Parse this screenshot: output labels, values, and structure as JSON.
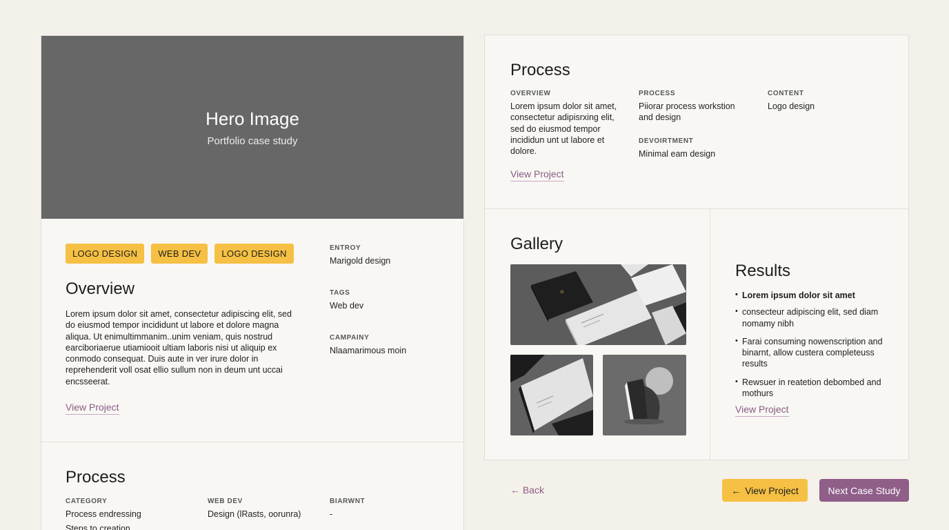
{
  "hero": {
    "title": "Hero Image",
    "subtitle": "Portfolio case study"
  },
  "overview": {
    "tags": [
      "LOGO DESIGN",
      "WEB DEV",
      "LOGO DESIGN"
    ],
    "heading": "Overview",
    "body": "Lorem ipsum dolor sit amet, consectetur adipiscing elit, sed do eiusmod tempor incididunt ut labore et dolore magna aliqua. Ut enimultimmanim..unim veniam, quis nostrud earciboriaerue utiamiooit ultiam laboris nisi ut aliquip ex conmodo consequat. Duis aute in ver irure dolor in reprehenderit voll osat ellio sullum non in deum unt uccai encsseerat.",
    "link": "View Project",
    "meta": [
      {
        "label": "ENTROY",
        "value": "Marigold design"
      },
      {
        "label": "TAGS",
        "value": "Web dev"
      },
      {
        "label": "CAMPAINY",
        "value": "Nlaamarimous moin"
      }
    ]
  },
  "process_left": {
    "heading": "Process",
    "columns": [
      {
        "label": "CATEGORY",
        "value": "Process endressing",
        "value2": "Steps to creation"
      },
      {
        "label": "WEB DEV",
        "value": "Design (lRasts, oorunra)"
      },
      {
        "label": "BIARWNT",
        "value": "-"
      }
    ]
  },
  "process_right": {
    "heading": "Process",
    "overview_label": "OVERVIEW",
    "overview_text": "Lorem ipsum dolor sit amet, consectetur adipisrxing elit, sed do eiusmod tempor incididun unt ut labore et dolore.",
    "process_label": "PROCESS",
    "process_text": "Piiorar process workstion and design",
    "devoirtment_label": "DEVOIRTMENT",
    "devoirtment_text": "Minimal eam design",
    "content_label": "CONTENT",
    "content_text": "Logo design",
    "link": "View Project"
  },
  "gallery": {
    "heading": "Gallery",
    "images": [
      "business-cards-stacked",
      "business-cards-close-up",
      "abstract-sculpture"
    ]
  },
  "results": {
    "heading": "Results",
    "items": [
      "Lorem ipsum dolor sit amet",
      "consecteur adipiscing elit, sed diam nomamy nibh",
      "Farai consuming nowenscription and binarnt, allow custera completeuss results",
      "Rewsuer in reatetion debombed and mothurs"
    ],
    "link": "View Project"
  },
  "footer": {
    "back": "Back",
    "view_project": "View Project",
    "next": "Next Case Study"
  },
  "colors": {
    "accent_yellow": "#f5c043",
    "accent_purple": "#8f5e89",
    "hero_gray": "#676767",
    "background": "#f4f1ea"
  }
}
